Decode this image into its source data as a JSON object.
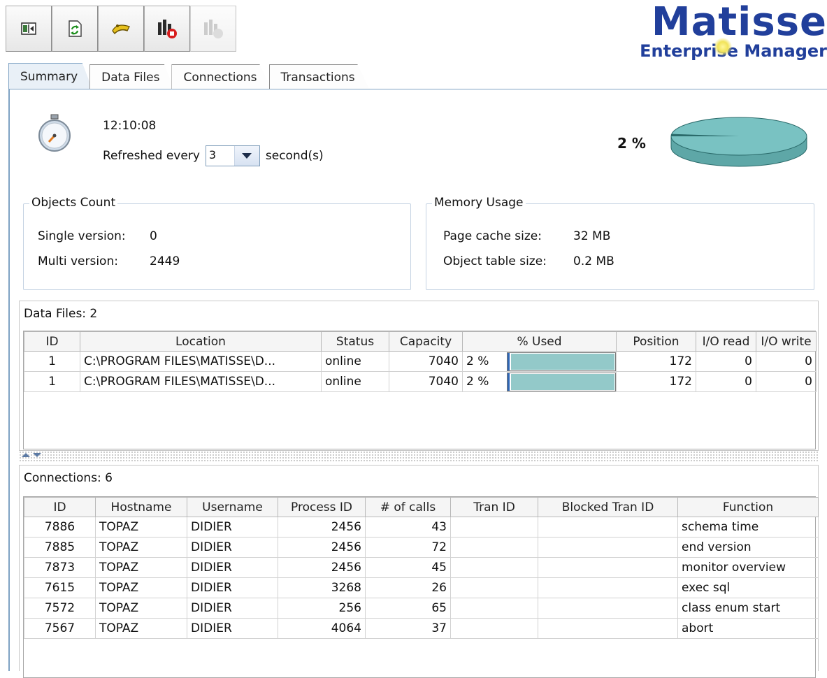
{
  "toolbar": {
    "buttons": [
      {
        "icon": "panel-toggle-icon"
      },
      {
        "icon": "refresh-icon"
      },
      {
        "icon": "connect-icon"
      },
      {
        "icon": "monitor-chart-icon"
      },
      {
        "icon": "monitor-chart-disabled-icon",
        "disabled": true
      }
    ]
  },
  "logo": {
    "title": "Matisse",
    "subtitle": "Enterprise Manager"
  },
  "tabs": [
    "Summary",
    "Data Files",
    "Connections",
    "Transactions"
  ],
  "summary": {
    "time": "12:10:08",
    "refresh_label": "Refreshed every",
    "refresh_value": "3",
    "refresh_unit": "second(s)",
    "usage_percent_label": "2 %",
    "usage_fraction": 0.02,
    "colors": {
      "pie": "#79c2c2",
      "pie_edge": "#2b6b6b",
      "bar_fill": "#93c9c9",
      "bar_marker": "#2f67b6"
    }
  },
  "objects_count": {
    "title": "Objects Count",
    "single_label": "Single version:",
    "single_value": "0",
    "multi_label": "Multi version:",
    "multi_value": "2449"
  },
  "memory_usage": {
    "title": "Memory Usage",
    "page_cache_label": "Page cache size:",
    "page_cache_value": "32 MB",
    "object_table_label": "Object table size:",
    "object_table_value": "0.2 MB"
  },
  "data_files": {
    "title": "Data Files: 2",
    "columns": [
      "ID",
      "Location",
      "Status",
      "Capacity",
      "% Used",
      "Position",
      "I/O read",
      "I/O write"
    ],
    "rows": [
      {
        "id": "1",
        "location": "C:\\PROGRAM FILES\\MATISSE\\D...",
        "status": "online",
        "capacity": "7040",
        "used": "2 %",
        "used_fraction": 0.02,
        "position": "172",
        "io_read": "0",
        "io_write": "0"
      },
      {
        "id": "1",
        "location": "C:\\PROGRAM FILES\\MATISSE\\D...",
        "status": "online",
        "capacity": "7040",
        "used": "2 %",
        "used_fraction": 0.02,
        "position": "172",
        "io_read": "0",
        "io_write": "0"
      }
    ]
  },
  "connections": {
    "title": "Connections: 6",
    "columns": [
      "ID",
      "Hostname",
      "Username",
      "Process ID",
      "# of calls",
      "Tran ID",
      "Blocked Tran ID",
      "Function"
    ],
    "rows": [
      {
        "id": "7886",
        "hostname": "TOPAZ",
        "username": "DIDIER",
        "process_id": "2456",
        "calls": "43",
        "tran_id": "",
        "blocked": "",
        "function": "schema time"
      },
      {
        "id": "7885",
        "hostname": "TOPAZ",
        "username": "DIDIER",
        "process_id": "2456",
        "calls": "72",
        "tran_id": "",
        "blocked": "",
        "function": "end version"
      },
      {
        "id": "7873",
        "hostname": "TOPAZ",
        "username": "DIDIER",
        "process_id": "2456",
        "calls": "45",
        "tran_id": "",
        "blocked": "",
        "function": "monitor overview"
      },
      {
        "id": "7615",
        "hostname": "TOPAZ",
        "username": "DIDIER",
        "process_id": "3268",
        "calls": "26",
        "tran_id": "",
        "blocked": "",
        "function": "exec sql"
      },
      {
        "id": "7572",
        "hostname": "TOPAZ",
        "username": "DIDIER",
        "process_id": "256",
        "calls": "65",
        "tran_id": "",
        "blocked": "",
        "function": "class enum start"
      },
      {
        "id": "7567",
        "hostname": "TOPAZ",
        "username": "DIDIER",
        "process_id": "4064",
        "calls": "37",
        "tran_id": "",
        "blocked": "",
        "function": "abort"
      }
    ]
  }
}
